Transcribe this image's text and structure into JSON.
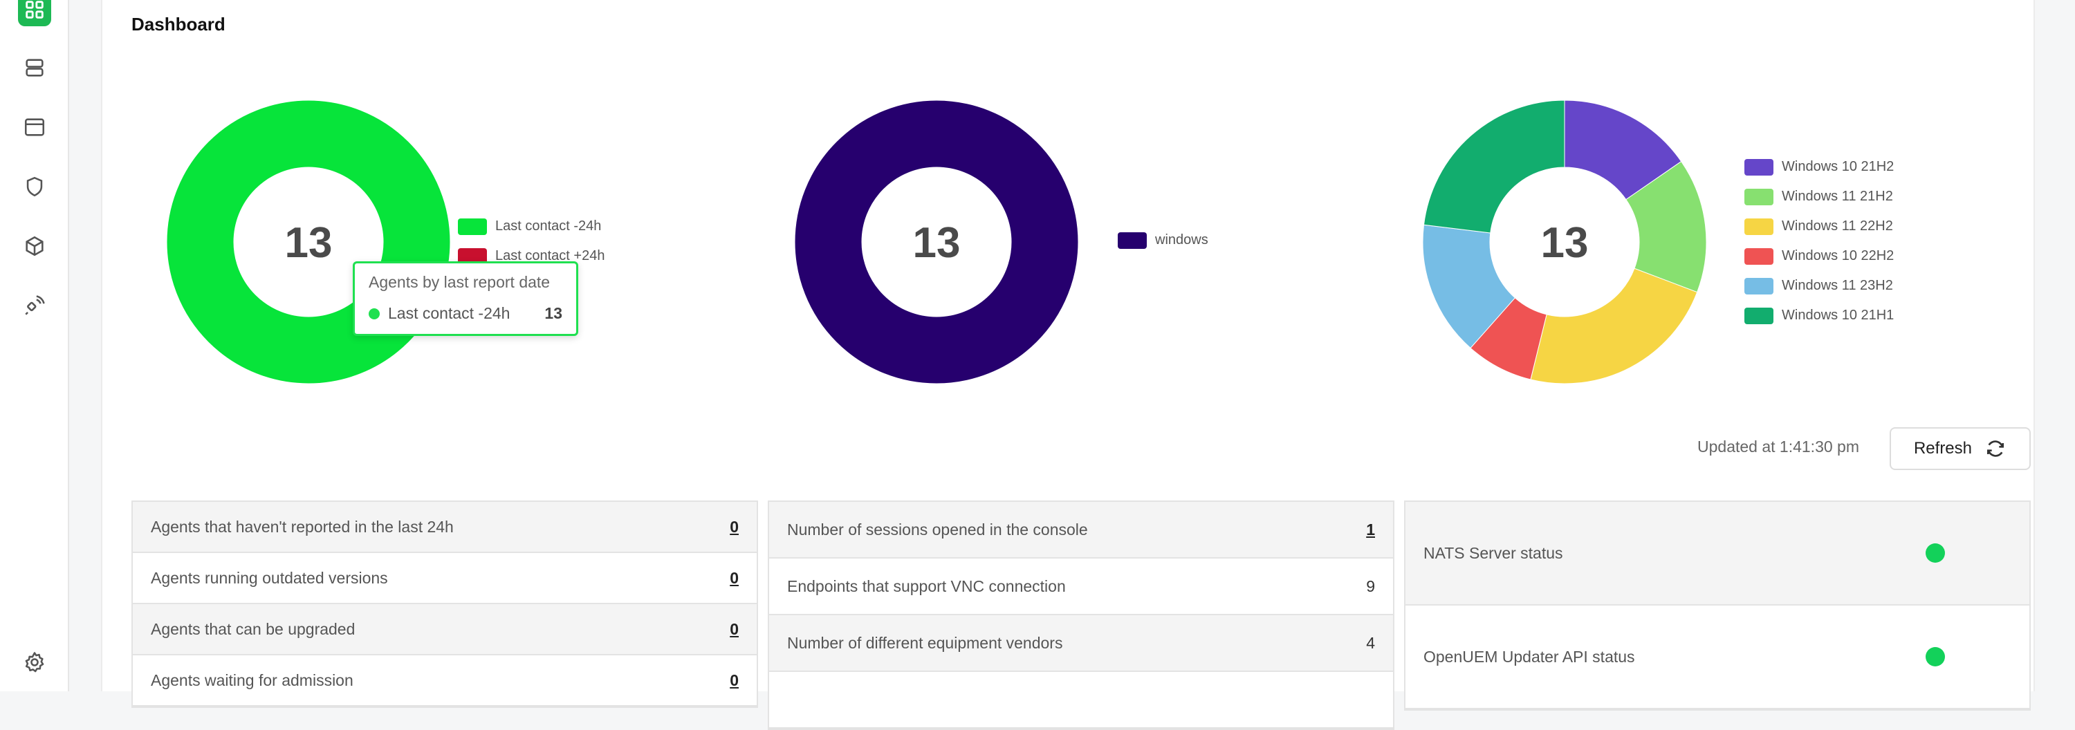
{
  "sidebar": {
    "items": [
      {
        "icon": "dashboard-icon",
        "active": true
      },
      {
        "icon": "server-icon"
      },
      {
        "icon": "window-icon"
      },
      {
        "icon": "shield-icon"
      },
      {
        "icon": "package-icon"
      },
      {
        "icon": "satellite-icon"
      },
      {
        "icon": "gear-icon"
      }
    ]
  },
  "page": {
    "title": "Dashboard"
  },
  "charts": [
    {
      "center": "13",
      "legend": [
        {
          "label": "Last contact -24h",
          "color": "#07e43a"
        },
        {
          "label": "Last contact +24h",
          "color": "#c8102e"
        }
      ],
      "tooltip": {
        "title": "Agents by last report date",
        "label": "Last contact -24h",
        "value": "13"
      }
    },
    {
      "center": "13",
      "legend": [
        {
          "label": "windows",
          "color": "#26006e"
        }
      ]
    },
    {
      "center": "13",
      "legend": [
        {
          "label": "Windows 10 21H2",
          "color": "#6546c9"
        },
        {
          "label": "Windows 11 21H2",
          "color": "#87e070"
        },
        {
          "label": "Windows 11 22H2",
          "color": "#f6d544"
        },
        {
          "label": "Windows 10 22H2",
          "color": "#ef5353"
        },
        {
          "label": "Windows 11 23H2",
          "color": "#76bde5"
        },
        {
          "label": "Windows 10 21H1",
          "color": "#12ad6e"
        }
      ]
    }
  ],
  "chart_data": [
    {
      "type": "pie",
      "categories": [
        "Last contact -24h",
        "Last contact +24h"
      ],
      "values": [
        13,
        0
      ],
      "colors": [
        "#07e43a",
        "#c8102e"
      ]
    },
    {
      "type": "pie",
      "categories": [
        "windows"
      ],
      "values": [
        13
      ],
      "colors": [
        "#26006e"
      ]
    },
    {
      "type": "pie",
      "categories": [
        "Windows 10 21H2",
        "Windows 11 21H2",
        "Windows 11 22H2",
        "Windows 10 22H2",
        "Windows 11 23H2",
        "Windows 10 21H1"
      ],
      "values": [
        2,
        2,
        3,
        1,
        2,
        3
      ],
      "colors": [
        "#6546c9",
        "#87e070",
        "#f6d544",
        "#ef5353",
        "#76bde5",
        "#12ad6e"
      ]
    }
  ],
  "status": {
    "updated": "Updated at 1:41:30 pm",
    "refresh_label": "Refresh"
  },
  "tables": {
    "agents": [
      {
        "label": "Agents that haven't reported in the last 24h",
        "value": "0"
      },
      {
        "label": "Agents running outdated versions",
        "value": "0"
      },
      {
        "label": "Agents that can be upgraded",
        "value": "0"
      },
      {
        "label": "Agents waiting for admission",
        "value": "0"
      }
    ],
    "endpoints": [
      {
        "label": "Number of sessions opened in the console",
        "value": "1"
      },
      {
        "label": "Endpoints that support VNC connection",
        "value": "9"
      },
      {
        "label": "Number of different equipment vendors",
        "value": "4"
      },
      {
        "label": "",
        "value": ""
      }
    ],
    "services": [
      {
        "label": "NATS Server status",
        "color": "#13d15a"
      },
      {
        "label": "OpenUEM Updater API status",
        "color": "#13d15a"
      }
    ]
  }
}
